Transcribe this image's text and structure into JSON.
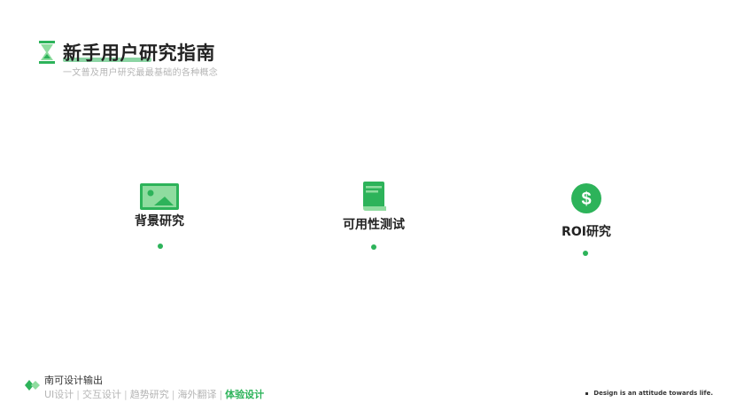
{
  "header": {
    "title": "新手用户研究指南",
    "subtitle": "一文普及用户研究最最基础的各种概念"
  },
  "items": [
    {
      "label": "背景研究",
      "icon": "image-icon"
    },
    {
      "label": "可用性测试",
      "icon": "book-icon"
    },
    {
      "label": "ROI研究",
      "icon": "dollar-icon"
    }
  ],
  "footer": {
    "brand": "南可设计输出",
    "nav": [
      "UI设计",
      "交互设计",
      "趋势研究",
      "海外翻译",
      "体验设计"
    ],
    "active_index": 4,
    "tagline": "Design is an attitude towards life."
  },
  "colors": {
    "accent": "#2db35a",
    "accent_light": "#8fdc9f"
  }
}
